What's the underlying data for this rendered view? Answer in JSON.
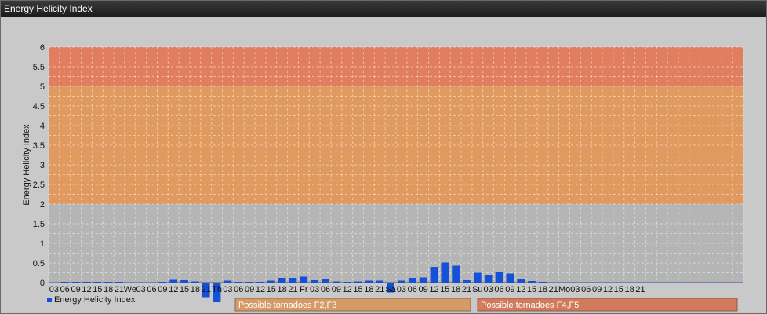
{
  "window": {
    "title": "Energy Helicity Index"
  },
  "chart_data": {
    "type": "bar",
    "ylabel": "Energy Helicity Index",
    "ylim": [
      0,
      6
    ],
    "yticks": [
      "0",
      "0.5",
      "1",
      "1.5",
      "2",
      "2.5",
      "3",
      "3.5",
      "4",
      "4.5",
      "5",
      "5.5",
      "6"
    ],
    "categories": [
      "03",
      "06",
      "09",
      "12",
      "15",
      "18",
      "21",
      "We",
      "03",
      "06",
      "09",
      "12",
      "15",
      "18",
      "21",
      "Th",
      "03",
      "06",
      "09",
      "12",
      "15",
      "18",
      "21",
      "Fr",
      "03",
      "06",
      "09",
      "12",
      "15",
      "18",
      "21",
      "Sa",
      "03",
      "06",
      "09",
      "12",
      "15",
      "18",
      "21",
      "Su",
      "03",
      "06",
      "09",
      "12",
      "15",
      "18",
      "21",
      "Mo",
      "03",
      "06",
      "09",
      "12",
      "15",
      "18",
      "21"
    ],
    "series": [
      {
        "name": "Energy Helicity Index",
        "color": "#1550d8",
        "values": [
          0.01,
          0.02,
          0.02,
          0.02,
          0.02,
          0.02,
          0.02,
          0.01,
          0.01,
          0.01,
          0.02,
          0.07,
          0.06,
          0.03,
          -0.37,
          -0.5,
          0.05,
          0.02,
          0.02,
          0.02,
          0.05,
          0.12,
          0.12,
          0.15,
          0.06,
          0.1,
          0.03,
          0.02,
          0.03,
          0.05,
          0.05,
          -0.25,
          0.05,
          0.12,
          0.13,
          0.4,
          0.51,
          0.43,
          0.06,
          0.25,
          0.2,
          0.26,
          0.23,
          0.08,
          0.04,
          0.02,
          0.01,
          0.01,
          0.01,
          0.01,
          0.01,
          0.01,
          0.01,
          0.01,
          0.01,
          0.01,
          0.01,
          0.01,
          0.01,
          0.01,
          0.01,
          0.01,
          0.01,
          0.01
        ]
      }
    ],
    "bands": [
      {
        "from": 0,
        "to": 2,
        "color": "#b5b5b5"
      },
      {
        "from": 2,
        "to": 5,
        "color": "#e09a60"
      },
      {
        "from": 5,
        "to": 6,
        "color": "#e27e60"
      }
    ],
    "legend_labels": [
      "Possible tornadoes F2,F3",
      "Possible tornadoes F4,F5"
    ],
    "legend_colors": [
      "#d49b66",
      "#d17b5c"
    ],
    "grid": true
  }
}
